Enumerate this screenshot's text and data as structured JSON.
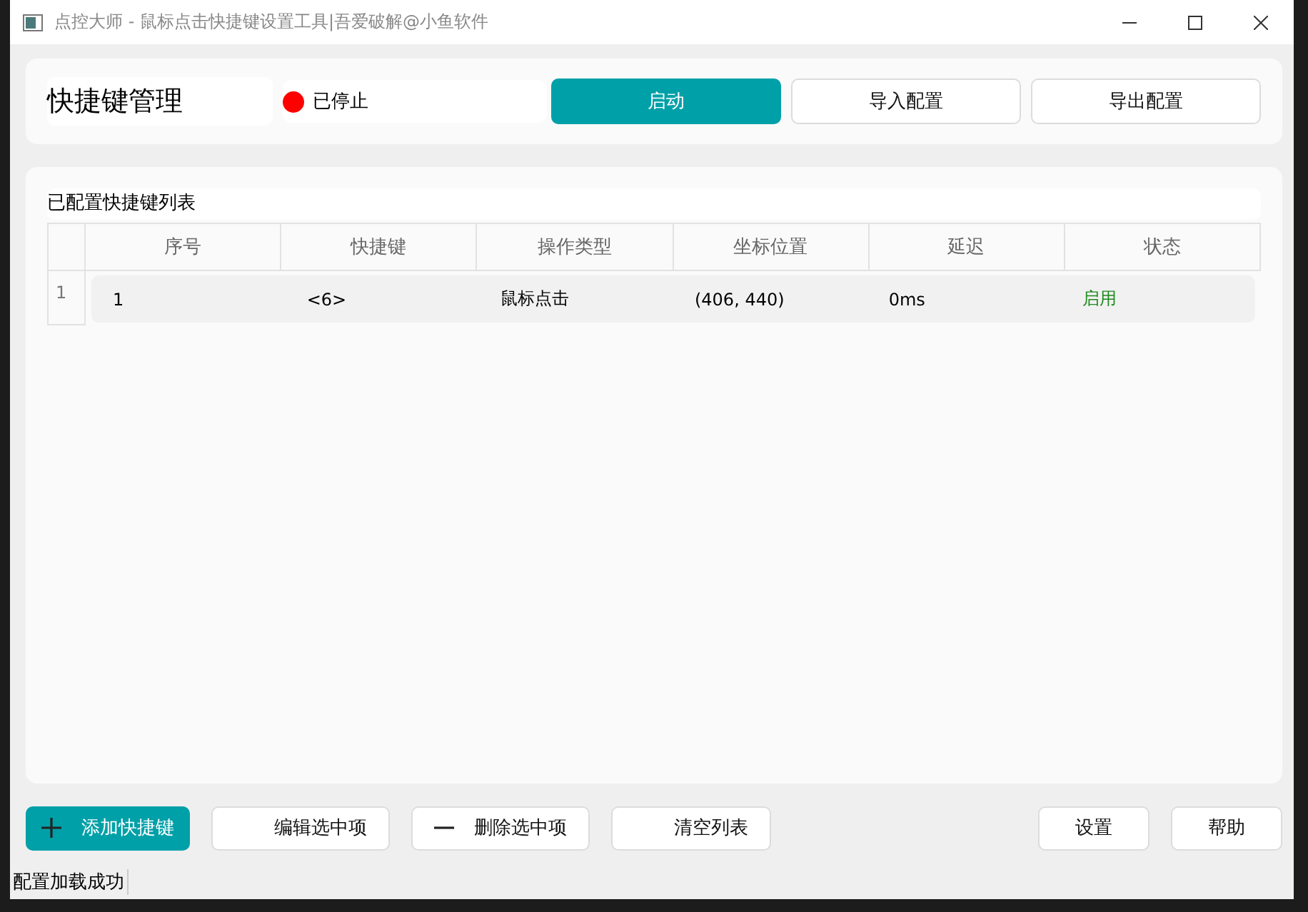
{
  "window": {
    "title": "点控大师 - 鼠标点击快捷键设置工具|吾爱破解@小鱼软件"
  },
  "header": {
    "title": "快捷键管理",
    "status": {
      "running": false,
      "label": "已停止"
    },
    "buttons": [
      {
        "label": "启动",
        "primary": true
      },
      {
        "label": "导入配置",
        "primary": false
      },
      {
        "label": "导出配置",
        "primary": false
      }
    ]
  },
  "table": {
    "title": "已配置快捷键列表",
    "columns": [
      "序号",
      "快捷键",
      "操作类型",
      "坐标位置",
      "延迟",
      "状态"
    ],
    "rows": [
      {
        "row_number": "1",
        "cells": [
          "1",
          "<6>",
          "鼠标点击",
          "(406, 440)",
          "0ms"
        ],
        "status": "启用",
        "enabled": true
      }
    ]
  },
  "actions": [
    {
      "label": "添加快捷键",
      "kind": "add",
      "primary": true
    },
    {
      "label": "编辑选中项",
      "kind": "plain",
      "primary": false
    },
    {
      "label": "删除选中项",
      "kind": "remove",
      "primary": false
    },
    {
      "label": "清空列表",
      "kind": "plain",
      "primary": false
    }
  ],
  "side_actions": [
    {
      "label": "设置"
    },
    {
      "label": "帮助"
    }
  ],
  "status_bar": "配置加载成功"
}
